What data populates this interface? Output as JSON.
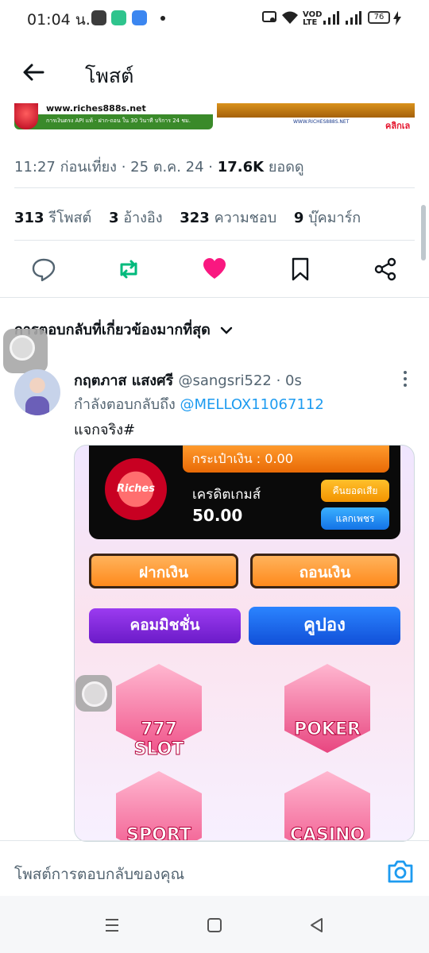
{
  "status_bar": {
    "time": "01:04 น.",
    "notif_icons": [
      "line-icon",
      "battery-saver-icon",
      "android-icon"
    ],
    "right_icons": [
      "screencast-icon",
      "wifi-icon",
      "volte-icon",
      "signal-icon",
      "signal-icon"
    ],
    "volte_text": "VOD LTE",
    "battery_level": "76"
  },
  "header": {
    "title": "โพสต์"
  },
  "banner": {
    "left_url": "www.riches888s.net",
    "left_sub": "การเงินตรง API แท้ · ฝาก-ถอน ใน 30 วินาที บริการ 24 ชม.",
    "right_url": "WWW.RICHES888S.NET",
    "right_cta": "คลิกเล"
  },
  "post_meta": {
    "time": "11:27 ก่อนเที่ยง",
    "date": "25 ต.ค. 24",
    "views_count": "17.6K",
    "views_label": "ยอดดู"
  },
  "stats": {
    "reposts_count": "313",
    "reposts_label": "รีโพสต์",
    "quotes_count": "3",
    "quotes_label": "อ้างอิง",
    "likes_count": "323",
    "likes_label": "ความชอบ",
    "bookmarks_count": "9",
    "bookmarks_label": "บุ๊คมาร์ก"
  },
  "colors": {
    "accent": "#1d9bf0",
    "repost_green": "#00ba7c",
    "like_pink": "#f91880",
    "secondary_text": "#536471"
  },
  "replies": {
    "sort_label": "การตอบกลับที่เกี่ยวข้องมากที่สุด",
    "items": [
      {
        "display_name": "กฤตภาส แสงศรี",
        "handle": "@sangsri522",
        "time": "0s",
        "replying_prefix": "กำลังตอบกลับถึง",
        "replying_to": "@MELLOX11067112",
        "text": "แจกจริง#",
        "media": {
          "wallet_balance": "กระเป๋าเงิน : 0.00",
          "logo_text": "Riches",
          "credit_label": "เครดิตเกมส์",
          "credit_value": "50.00",
          "refund_btn": "คืนยอดเสีย",
          "gems_btn": "แลกเพชร",
          "deposit_btn": "ฝากเงิน",
          "withdraw_btn": "ถอนเงิน",
          "commission_btn": "คอมมิชชั่น",
          "coupon_btn": "คูปอง",
          "games": [
            "777 SLOT",
            "POKER",
            "SPORT",
            "CASINO"
          ]
        }
      }
    ]
  },
  "composer": {
    "placeholder": "โพสต์การตอบกลับของคุณ"
  }
}
